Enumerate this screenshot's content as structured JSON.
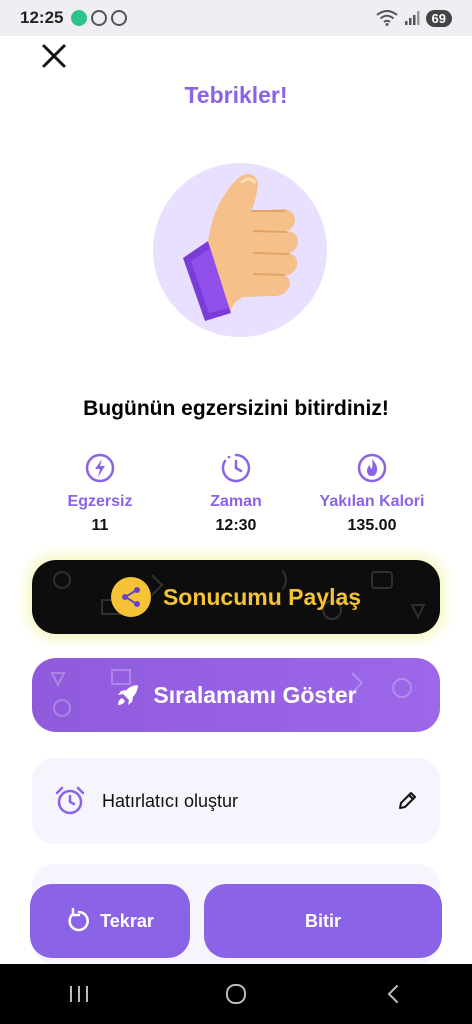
{
  "status_bar": {
    "time": "12:25",
    "battery": "69"
  },
  "header": {
    "title": "Tebrikler!"
  },
  "headline": "Bugünün egzersizini bitirdiniz!",
  "stats": [
    {
      "label": "Egzersiz",
      "value": "11",
      "icon": "lightning-icon"
    },
    {
      "label": "Zaman",
      "value": "12:30",
      "icon": "timer-icon"
    },
    {
      "label": "Yakılan Kalori",
      "value": "135.00",
      "icon": "flame-icon"
    }
  ],
  "buttons": {
    "share_label": "Sonucumu Paylaş",
    "rank_label": "Sıralamamı Göster",
    "retry_label": "Tekrar",
    "finish_label": "Bitir"
  },
  "reminder": {
    "label": "Hatırlatıcı oluştur"
  },
  "colors": {
    "accent": "#8a63e6",
    "share_text": "#f5c335",
    "card_bg": "#f6f4fc"
  }
}
